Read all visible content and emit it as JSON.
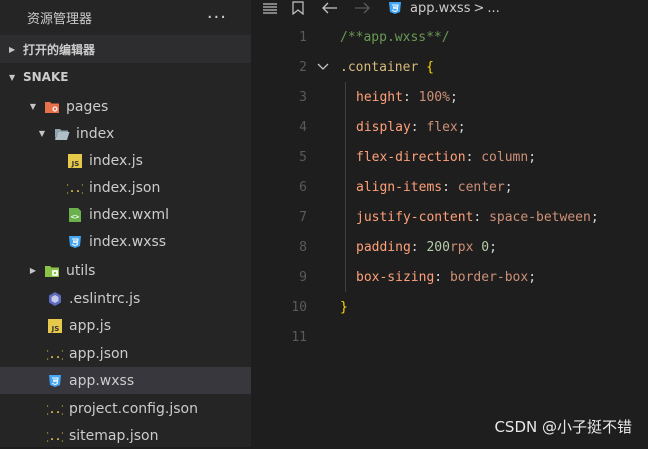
{
  "sidebar": {
    "title": "资源管理器",
    "more_label": "···",
    "open_editors_label": "打开的编辑器",
    "project_label": "SNAKE",
    "items": [
      {
        "label": "pages",
        "icon": "folder-pages-icon"
      },
      {
        "label": "index",
        "icon": "folder-open-icon"
      },
      {
        "label": "index.js",
        "icon": "js-file-icon"
      },
      {
        "label": "index.json",
        "icon": "json-file-icon"
      },
      {
        "label": "index.wxml",
        "icon": "wxml-file-icon"
      },
      {
        "label": "index.wxss",
        "icon": "css-file-icon"
      },
      {
        "label": "utils",
        "icon": "folder-utils-icon"
      },
      {
        "label": ".eslintrc.js",
        "icon": "eslint-file-icon"
      },
      {
        "label": "app.js",
        "icon": "js-file-icon"
      },
      {
        "label": "app.json",
        "icon": "json-file-icon"
      },
      {
        "label": "app.wxss",
        "icon": "css-file-icon"
      },
      {
        "label": "project.config.json",
        "icon": "json-file-icon"
      },
      {
        "label": "sitemap.json",
        "icon": "json-file-icon"
      }
    ],
    "selected": "app.wxss"
  },
  "editor": {
    "breadcrumb_file": "app.wxss",
    "breadcrumb_sep": ">",
    "breadcrumb_more": "...",
    "line_numbers": [
      "1",
      "2",
      "3",
      "4",
      "5",
      "6",
      "7",
      "8",
      "9",
      "10",
      "11"
    ],
    "code": {
      "l1": "/**app.wxss**/",
      "l2_sel": ".container",
      "l2_brace": "{",
      "l3_prop": "height",
      "l3_val": "100%",
      "l4_prop": "display",
      "l4_val": "flex",
      "l5_prop": "flex-direction",
      "l5_val": "column",
      "l6_prop": "align-items",
      "l6_val": "center",
      "l7_prop": "justify-content",
      "l7_val": "space-between",
      "l8_prop": "padding",
      "l8_num1": "200",
      "l8_unit": "rpx",
      "l8_num2": "0",
      "l9_prop": "box-sizing",
      "l9_val": "border-box",
      "l10_brace": "}"
    }
  },
  "watermark": "CSDN @小子挺不错",
  "colors": {
    "sidebar_bg": "#252526",
    "editor_bg": "#1e1e1e",
    "selection_bg": "#37373d",
    "comment": "#6a9955",
    "value": "#ce9178",
    "brace": "#ffd700"
  }
}
